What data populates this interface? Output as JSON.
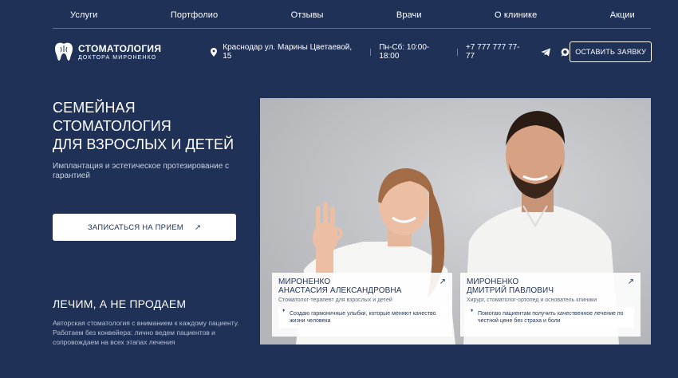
{
  "nav": {
    "items": [
      "Услуги",
      "Портфолио",
      "Отзывы",
      "Врачи",
      "О клинике",
      "Акции"
    ]
  },
  "header": {
    "logo_title": "СТОМАТОЛОГИЯ",
    "logo_subtitle": "ДОКТОРА МИРОНЕНКО",
    "address": "Краснодар ул. Марины Цветаевой, 15",
    "hours": "Пн-Сб: 10:00-18:00",
    "phone": "+7 777 777 77-77",
    "social_icons": [
      "telegram-icon",
      "chat-icon"
    ],
    "cta_label": "ОСТАВИТЬ ЗАЯВКУ"
  },
  "hero": {
    "title_lines": [
      "СЕМЕЙНАЯ",
      "СТОМАТОЛОГИЯ",
      "ДЛЯ ВЗРОСЛЫХ И ДЕТЕЙ"
    ],
    "subtitle": "Имплантация и эстетическое протезирование с гарантией",
    "book_label": "ЗАПИСАТЬСЯ НА ПРИЕМ",
    "book_arrow": "↗",
    "motto": "ЛЕЧИМ, А НЕ ПРОДАЕМ",
    "motto_text": "Авторская стоматология с вниманием к каждому пациенту. Работаем без конвейера: лично ведем пациентов и сопровождаем на всех этапах лечения"
  },
  "doctors": [
    {
      "surname": "МИРОНЕНКО",
      "name": "АНАСТАСИЯ АЛЕКСАНДРОВНА",
      "role": "Стоматолог-терапевт для взрослых и детей",
      "quote": "Создаю гармоничные улыбки, которые меняют качество жизни человека",
      "arrow": "↗"
    },
    {
      "surname": "МИРОНЕНКО",
      "name": "ДМИТРИЙ ПАВЛОВИЧ",
      "role": "Хирург, стоматолог-ортопед и основатель клиники",
      "quote": "Помогаю пациентам получить качественное лечение по честной цене без страха и боли",
      "arrow": "↗"
    }
  ],
  "colors": {
    "background": "#1f3156",
    "accent_text": "#ffffff",
    "muted_text": "#c7d0e2",
    "button_bg": "#ffffff"
  }
}
